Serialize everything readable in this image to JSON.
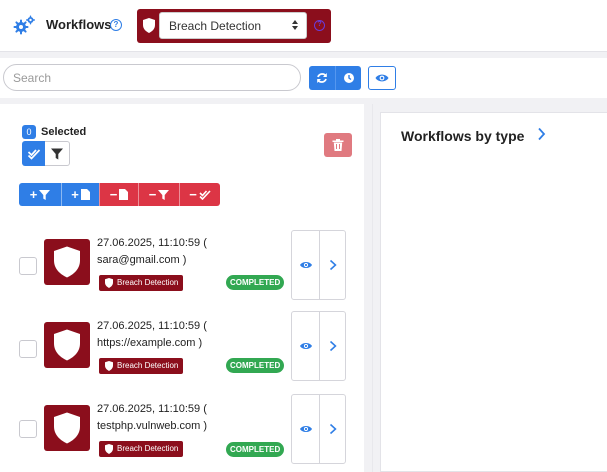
{
  "header": {
    "title": "Workflows",
    "module_selected": "Breach Detection",
    "brand_color": "#8b0e1c",
    "accent_color": "#2f7ee6"
  },
  "search": {
    "placeholder": "Search",
    "value": ""
  },
  "selection": {
    "count": "0",
    "label": "Selected"
  },
  "chart_panel": {
    "title": "Workflows by type"
  },
  "rows": [
    {
      "date": "27.06.2025, 11:10:59 (",
      "target": "sara@gmail.com )",
      "badge": "Breach Detection",
      "status": "COMPLETED"
    },
    {
      "date": "27.06.2025, 11:10:59 (",
      "target": "https://example.com )",
      "badge": "Breach Detection",
      "status": "COMPLETED"
    },
    {
      "date": "27.06.2025, 11:10:59 (",
      "target": "testphp.vulnweb.com )",
      "badge": "Breach Detection",
      "status": "COMPLETED"
    }
  ],
  "icons": {
    "header": "gears-icon",
    "module": "shield-icon",
    "refresh": "refresh-icon",
    "schedule": "clock-icon",
    "view": "eye-icon",
    "delete": "trash-icon",
    "open": "chevron-right-icon"
  }
}
